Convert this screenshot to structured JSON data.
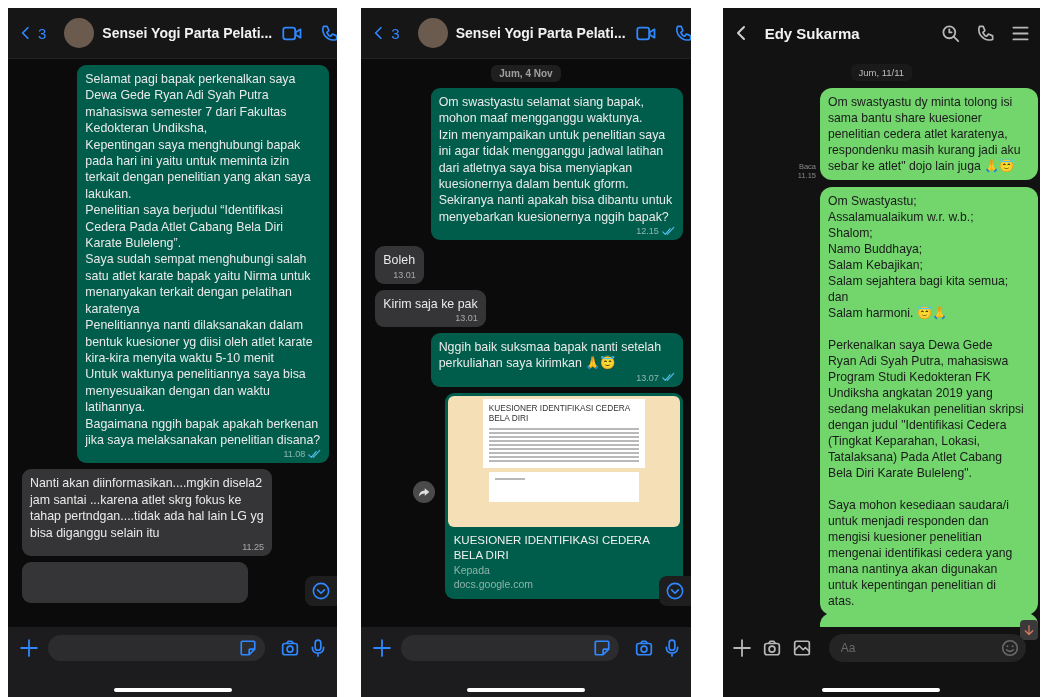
{
  "phones": [
    {
      "kind": "whatsapp",
      "header": {
        "back_count": "3",
        "title": "Sensei Yogi Parta Pelati..."
      },
      "messages": [
        {
          "kind": "out",
          "text": "Selamat pagi bapak perkenalkan saya Dewa Gede Ryan Adi Syah Putra mahasiswa semester 7 dari Fakultas Kedokteran Undiksha,\nKepentingan saya menghubungi bapak pada hari ini yaitu untuk meminta izin terkait dengan penelitian yang akan saya lakukan.\nPenelitian saya berjudul “Identifikasi Cedera Pada Atlet Cabang Bela Diri Karate Buleleng”.\nSaya sudah sempat menghubungi salah satu atlet karate bapak yaitu Nirma untuk menanyakan terkait dengan pelatihan karatenya\nPenelitiannya nanti dilaksanakan dalam bentuk kuesioner yg diisi oleh atlet karate kira-kira menyita waktu 5-10 menit\nUntuk waktunya penelitiannya saya bisa menyesuaikan dengan dan waktu latihannya.\nBagaimana nggih bapak apakah berkenan jika saya melaksanakan penelitian disana?",
          "time": "11.08",
          "read": true
        },
        {
          "kind": "in",
          "text": "Nanti akan diinformasikan....mgkin disela2 jam santai ...karena atlet skrg fokus ke tahap pertndgan....tidak ada hal lain LG yg bisa diganggu selain itu",
          "time": "11.25"
        },
        {
          "kind": "stub_in"
        }
      ]
    },
    {
      "kind": "whatsapp",
      "header": {
        "back_count": "3",
        "title": "Sensei Yogi Parta Pelati..."
      },
      "date": "Jum, 4 Nov",
      "messages": [
        {
          "kind": "out",
          "text": "Om swastyastu selamat siang bapak, mohon maaf mengganggu waktunya.\nIzin menyampaikan untuk penelitian saya ini agar tidak mengganggu jadwal latihan dari atletnya saya bisa menyiapkan kuesionernya dalam bentuk gform.\nSekiranya nanti apakah bisa dibantu untuk menyebarkan kuesionernya nggih bapak?",
          "time": "12.15",
          "read": true
        },
        {
          "kind": "in",
          "text": "Boleh",
          "time": "13.01"
        },
        {
          "kind": "in",
          "text": "Kirim saja ke pak",
          "time": "13.01"
        },
        {
          "kind": "out",
          "text": "Nggih baik suksmaa bapak nanti setelah perkuliahan saya kirimkan 🙏😇",
          "time": "13.07",
          "read": true
        },
        {
          "kind": "link",
          "preview_title": "KUESIONER IDENTIFIKASI CEDERA BELA DIRI",
          "title": "KUESIONER IDENTIFIKASI CEDERA BELA DIRI",
          "description": "Kepada",
          "domain": "docs.google.com"
        }
      ]
    },
    {
      "kind": "line",
      "header": {
        "title": "Edy Sukarma"
      },
      "date": "Jum, 11/11",
      "composer": {
        "placeholder": "Aa"
      },
      "messages": [
        {
          "kind": "out",
          "text": "Om swastyastu dy minta tolong isi sama bantu share kuesioner penelitian cedera atlet karatenya, respondenku masih kurang jadi aku sebar ke atlet\" dojo lain juga 🙏😇",
          "receipt": "Baca",
          "time": "11.15"
        },
        {
          "kind": "out",
          "text": "Om Swastyastu;\nAssalamualaikum w.r. w.b.;\nShalom;\nNamo Buddhaya;\nSalam Kebajikan;\nSalam sejahtera bagi kita semua;\ndan\nSalam harmoni. 😇🙏\n\nPerkenalkan saya Dewa Gede Ryan Adi Syah Putra, mahasiswa Program Studi Kedokteran FK Undiksha angkatan 2019 yang sedang melakukan penelitian skripsi dengan judul \"Identifikasi Cedera (Tingkat Keparahan, Lokasi, Tatalaksana) Pada Atlet Cabang Bela Diri Karate Buleleng\".\n\nSaya mohon kesediaan saudara/i untuk menjadi responden dan mengisi kuesioner penelitian mengenai identifikasi cedera yang mana nantinya akan digunakan untuk kepentingan penelitian di atas."
        },
        {
          "kind": "stub_out"
        }
      ]
    }
  ]
}
